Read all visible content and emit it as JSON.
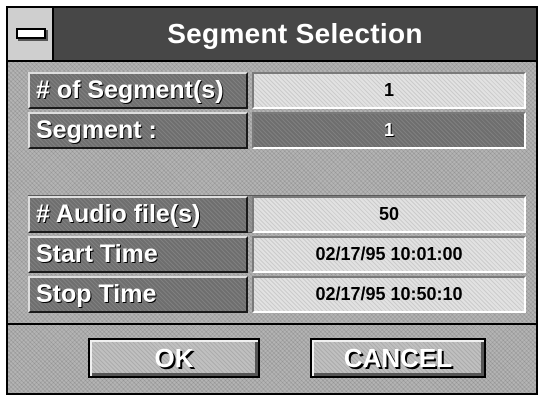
{
  "window": {
    "title": "Segment Selection",
    "system_menu_icon": "system-menu-icon"
  },
  "fields": {
    "num_segments": {
      "label": "# of Segment(s)",
      "value": "1"
    },
    "segment": {
      "label": "Segment :",
      "value": "1"
    },
    "num_audio_files": {
      "label": "# Audio file(s)",
      "value": "50"
    },
    "start_time": {
      "label": "Start Time",
      "value": "02/17/95 10:01:00"
    },
    "stop_time": {
      "label": "Stop Time",
      "value": "02/17/95 10:50:10"
    }
  },
  "buttons": {
    "ok_label": "OK",
    "cancel_label": "CANCEL"
  },
  "colors": {
    "title_bar": "#474747",
    "label_background": "#6e6e6e",
    "value_background": "#e2e2e2",
    "dialog_background": "#b4b4b4"
  }
}
